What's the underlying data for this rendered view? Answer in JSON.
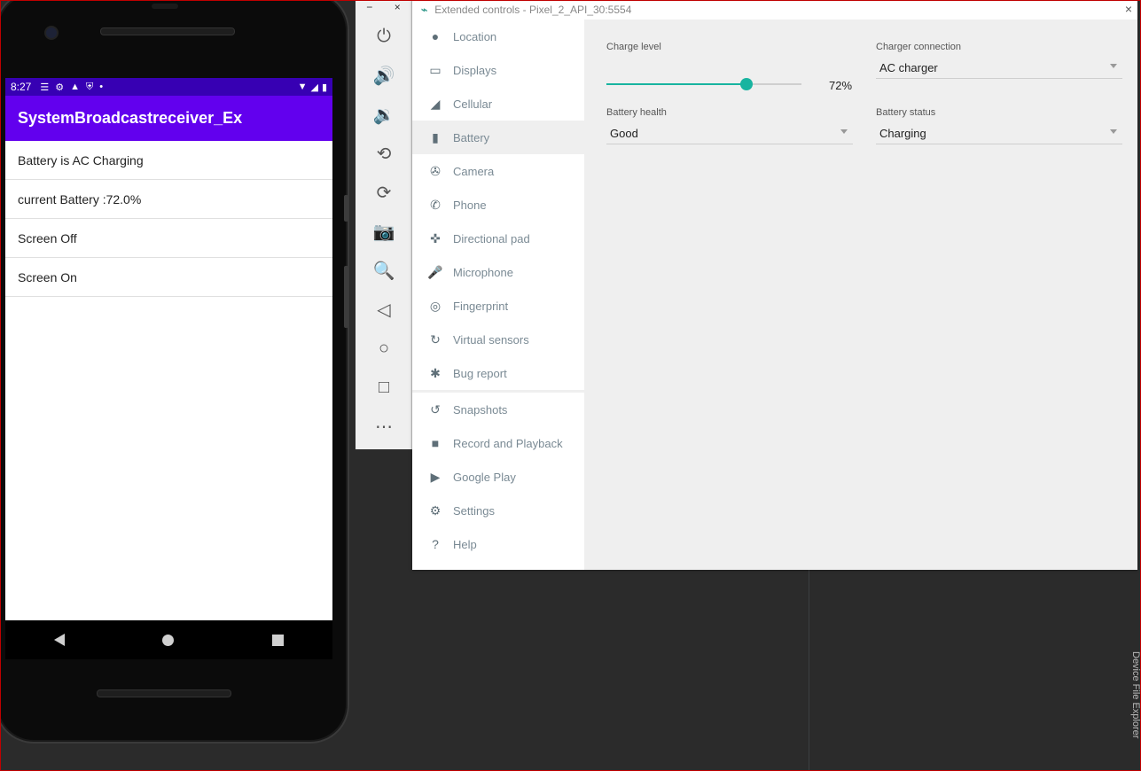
{
  "phone": {
    "status_time": "8:27",
    "status_icons": [
      "notes-icon",
      "settings-icon",
      "a-icon",
      "shield-icon",
      "dot-icon"
    ],
    "app_title": "SystemBroadcastreceiver_Ex",
    "list": [
      {
        "text": "Battery is AC Charging"
      },
      {
        "text": "current Battery :72.0%"
      },
      {
        "text": "Screen Off"
      },
      {
        "text": "Screen On"
      }
    ]
  },
  "toolbar": {
    "minimize": "−",
    "close": "×",
    "buttons": [
      "power-icon",
      "volume-up-icon",
      "volume-down-icon",
      "rotate-left-icon",
      "rotate-right-icon",
      "camera-icon",
      "zoom-icon",
      "back-icon",
      "home-icon",
      "overview-icon",
      "more-icon"
    ]
  },
  "ext": {
    "title": "Extended controls - Pixel_2_API_30:5554",
    "close": "×",
    "sidebar": [
      {
        "label": "Location",
        "icon": "pin-icon"
      },
      {
        "label": "Displays",
        "icon": "display-icon"
      },
      {
        "label": "Cellular",
        "icon": "signal-icon"
      },
      {
        "label": "Battery",
        "icon": "battery-icon",
        "active": true
      },
      {
        "label": "Camera",
        "icon": "camera-aperture-icon"
      },
      {
        "label": "Phone",
        "icon": "phone-icon"
      },
      {
        "label": "Directional pad",
        "icon": "dpad-icon"
      },
      {
        "label": "Microphone",
        "icon": "mic-icon"
      },
      {
        "label": "Fingerprint",
        "icon": "fingerprint-icon"
      },
      {
        "label": "Virtual sensors",
        "icon": "sensor-icon"
      },
      {
        "label": "Bug report",
        "icon": "bug-icon"
      },
      {
        "label": "Snapshots",
        "icon": "history-icon"
      },
      {
        "label": "Record and Playback",
        "icon": "video-icon"
      },
      {
        "label": "Google Play",
        "icon": "play-icon"
      },
      {
        "label": "Settings",
        "icon": "gear-icon"
      },
      {
        "label": "Help",
        "icon": "help-icon"
      }
    ],
    "battery": {
      "charge_level_label": "Charge level",
      "charge_value": "72%",
      "charge_fraction": 0.72,
      "charger_label": "Charger connection",
      "charger_value": "AC charger",
      "health_label": "Battery health",
      "health_value": "Good",
      "status_label": "Battery status",
      "status_value": "Charging"
    }
  },
  "ide": {
    "side_tab": "Device File Explorer"
  },
  "colors": {
    "status_bar": "#3700b3",
    "app_bar": "#6200ee",
    "accent": "#18b4a0"
  }
}
